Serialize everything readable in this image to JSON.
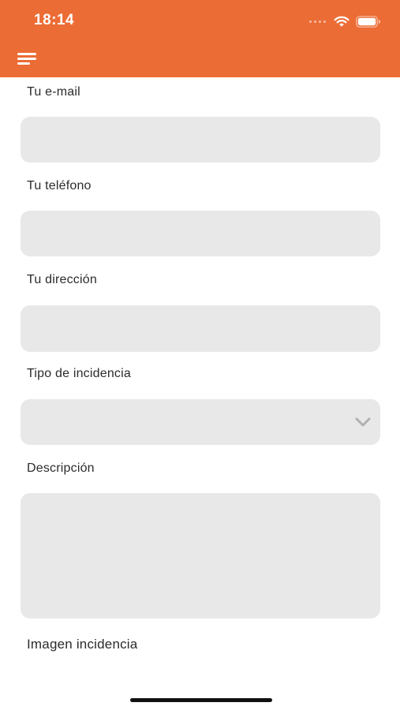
{
  "status_bar": {
    "time": "18:14"
  },
  "colors": {
    "accent": "#EC6C35",
    "field_background": "#E8E8E8",
    "label_text": "#2b2b2b"
  },
  "header": {
    "menu_icon": "hamburger-menu-icon"
  },
  "form": {
    "email_label": "Tu e-mail",
    "email_value": "",
    "phone_label": "Tu teléfono",
    "phone_value": "",
    "address_label": "Tu dirección",
    "address_value": "",
    "incident_type_label": "Tipo de incidencia",
    "incident_type_selected": "",
    "incident_type_icon": "chevron-down-icon",
    "description_label": "Descripción",
    "description_value": "",
    "image_label": "Imagen incidencia"
  }
}
